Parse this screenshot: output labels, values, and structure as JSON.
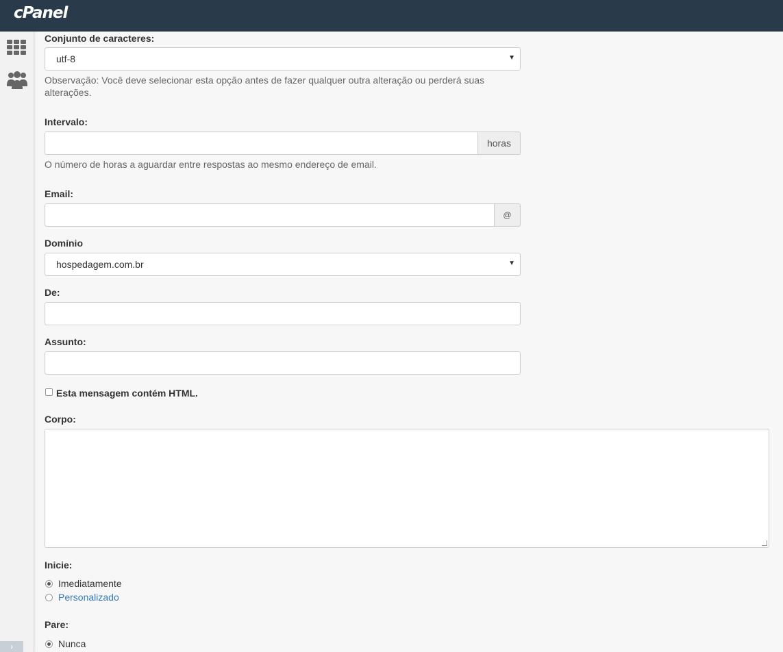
{
  "header": {
    "logo_text": "cPanel"
  },
  "sidebar": {
    "icons": [
      "grid-icon",
      "users-icon"
    ],
    "expand_icon": "›"
  },
  "form": {
    "charset": {
      "label": "Conjunto de caracteres:",
      "value": "utf-8",
      "note": "Observação: Você deve selecionar esta opção antes de fazer qualquer outra alteração ou perderá suas alterações."
    },
    "interval": {
      "label": "Intervalo:",
      "value": "",
      "addon": "horas",
      "help": "O número de horas a aguardar entre respostas ao mesmo endereço de email."
    },
    "email": {
      "label": "Email:",
      "value": "",
      "addon": "@"
    },
    "domain": {
      "label": "Domínio",
      "value": "hospedagem.com.br"
    },
    "from": {
      "label": "De:",
      "value": ""
    },
    "subject": {
      "label": "Assunto:",
      "value": ""
    },
    "html_checkbox": {
      "label": "Esta mensagem contém HTML.",
      "checked": false
    },
    "body": {
      "label": "Corpo:",
      "value": ""
    },
    "start": {
      "label": "Inicie:",
      "options": [
        {
          "label": "Imediatamente",
          "checked": true
        },
        {
          "label": "Personalizado",
          "checked": false
        }
      ]
    },
    "stop": {
      "label": "Pare:",
      "options": [
        {
          "label": "Nunca",
          "checked": true
        }
      ]
    }
  },
  "colors": {
    "header_bg": "#293a4a",
    "link": "#337ab7"
  }
}
